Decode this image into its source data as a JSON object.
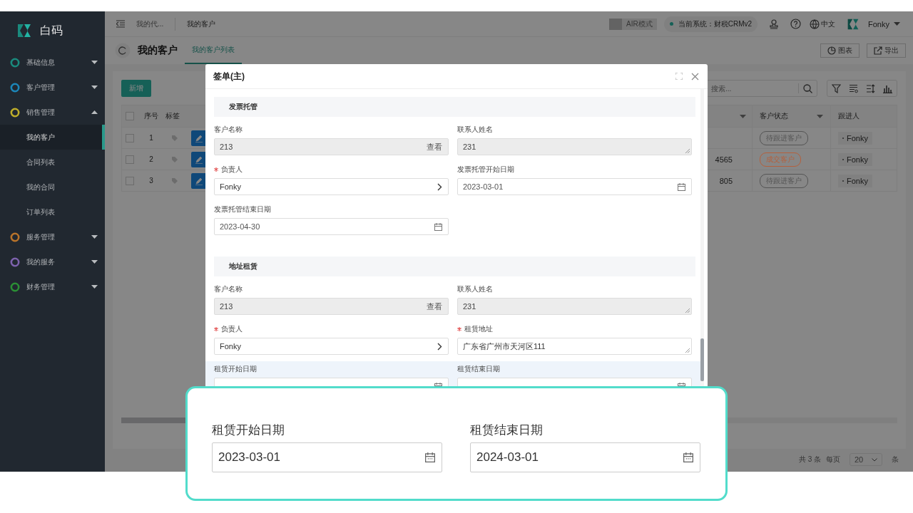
{
  "sidebar": {
    "logo_text": "白码",
    "items": [
      {
        "label": "基础信息",
        "color": "#1a8a7d",
        "expanded": false
      },
      {
        "label": "客户管理",
        "color": "#1c86b8",
        "expanded": false
      },
      {
        "label": "销售管理",
        "color": "#bfae2a",
        "expanded": true,
        "children": [
          {
            "label": "我的客户",
            "selected": true
          },
          {
            "label": "合同列表",
            "selected": false
          },
          {
            "label": "我的合同",
            "selected": false
          },
          {
            "label": "订单列表",
            "selected": false
          }
        ]
      },
      {
        "label": "服务管理",
        "color": "#b8732a",
        "expanded": false
      },
      {
        "label": "我的服务",
        "color": "#7d62ad",
        "expanded": false
      },
      {
        "label": "财务管理",
        "color": "#2b8f35",
        "expanded": false
      }
    ]
  },
  "header": {
    "breadcrumbs": [
      {
        "label": "我的代...",
        "selected": false
      },
      {
        "label": "我的客户",
        "selected": true
      }
    ],
    "air_mode": {
      "label": "AIR模式",
      "on": false
    },
    "system": "当前系统：财税CRMv2",
    "language": "中文",
    "user": "Fonky"
  },
  "page": {
    "title": "我的客户",
    "tabs": [
      {
        "label": "我的客户列表",
        "selected": true
      }
    ],
    "actions": [
      {
        "label": "图表",
        "kind": "chart"
      },
      {
        "label": "导出",
        "kind": "export"
      }
    ]
  },
  "toolbar": {
    "add_button": "新增",
    "search_placeholder": "搜索..."
  },
  "table": {
    "all_checked": false,
    "columns": {
      "index": "序号",
      "tag": "标签",
      "status": "客户状态",
      "follower": "跟进人"
    },
    "rows": [
      {
        "index": "1",
        "checked": false,
        "status": "待跟进客户",
        "color": "#555555",
        "follower": "Fonky"
      },
      {
        "index": "2",
        "checked": false,
        "column_4": "4565",
        "status": "成交客户",
        "color": "#b5603c",
        "follower": "Fonky"
      },
      {
        "index": "3",
        "checked": false,
        "column_4": "805",
        "status": "待跟进客户",
        "color": "#555555",
        "follower": "Fonky"
      }
    ]
  },
  "pagination": {
    "total": "共 3 条",
    "per_page_label": "每页",
    "page_size": "20",
    "unit": "条"
  },
  "dialog": {
    "title": "签单(主)",
    "sections": [
      {
        "title": "发票托管",
        "fields": [
          {
            "label": "客户名称",
            "kind": "lookup",
            "required": false,
            "readonly": true,
            "value": "213",
            "action": "查看"
          },
          {
            "label": "联系人姓名",
            "kind": "textarea",
            "required": false,
            "readonly": true,
            "value": "231"
          },
          {
            "label": "负责人",
            "kind": "select",
            "required": true,
            "readonly": false,
            "value": "Fonky"
          },
          {
            "label": "发票托管开始日期",
            "kind": "date",
            "required": false,
            "readonly": false,
            "value": "2023-03-01"
          },
          {
            "label": "发票托管结束日期",
            "kind": "date",
            "required": false,
            "readonly": false,
            "value": "2023-04-30"
          }
        ]
      },
      {
        "title": "地址租赁",
        "fields": [
          {
            "label": "客户名称",
            "kind": "lookup",
            "required": false,
            "readonly": true,
            "value": "213",
            "action": "查看"
          },
          {
            "label": "联系人姓名",
            "kind": "textarea",
            "required": false,
            "readonly": true,
            "value": "231"
          },
          {
            "label": "负责人",
            "kind": "select",
            "required": true,
            "readonly": false,
            "value": "Fonky"
          },
          {
            "label": "租赁地址",
            "kind": "textarea",
            "required": true,
            "readonly": false,
            "value": "广东省广州市天河区111"
          },
          {
            "label": "租赁开始日期",
            "kind": "date",
            "required": false,
            "readonly": false
          },
          {
            "label": "租赁结束日期",
            "kind": "date",
            "required": false,
            "readonly": false
          }
        ]
      }
    ]
  },
  "callout": {
    "fields": [
      {
        "label": "租赁开始日期",
        "value": "2023-03-01"
      },
      {
        "label": "租赁结束日期",
        "value": "2024-03-01"
      }
    ]
  }
}
